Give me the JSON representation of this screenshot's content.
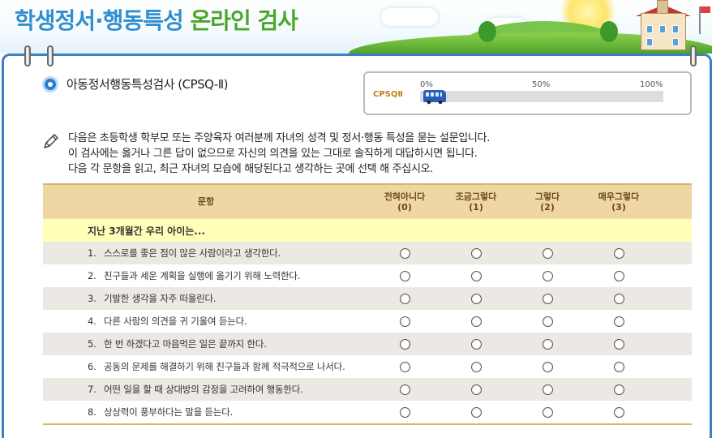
{
  "header": {
    "title_part1": "학생정서·행동특성 ",
    "title_part2": "온라인 검사"
  },
  "page": {
    "title": "아동정서행동특성검사 (CPSQ-Ⅱ)"
  },
  "progress": {
    "code": "CPSQⅡ",
    "ticks": [
      "0%",
      "50%",
      "100%"
    ],
    "percent": 0
  },
  "instructions": [
    "다음은 초등학생 학부모 또는 주양육자 여러분께 자녀의 성격 및 정서·행동 특성을 묻는 설문입니다.",
    "이 검사에는 옳거나 그른 답이 없으므로 자신의 의견을 있는 그대로 솔직하게 대답하시면 됩니다.",
    "다음 각 문항을 읽고, 최근 자녀의 모습에 해당된다고 생각하는 곳에 선택 해 주십시오."
  ],
  "table": {
    "col_question": "문항",
    "options": [
      {
        "label": "전혀아니다",
        "value": "(0)"
      },
      {
        "label": "조금그렇다",
        "value": "(1)"
      },
      {
        "label": "그렇다",
        "value": "(2)"
      },
      {
        "label": "매우그렇다",
        "value": "(3)"
      }
    ],
    "section": "지난 3개월간 우리 아이는...",
    "questions": [
      {
        "num": "1.",
        "text": "스스로를 좋은 점이 많은 사람이라고 생각한다."
      },
      {
        "num": "2.",
        "text": "친구들과 세운 계획을 실행에 옮기기 위해 노력한다."
      },
      {
        "num": "3.",
        "text": "기발한 생각을 자주 떠올린다."
      },
      {
        "num": "4.",
        "text": "다른 사람의 의견을 귀 기울여 듣는다."
      },
      {
        "num": "5.",
        "text": "한 번 하겠다고 마음먹은 일은 끝까지 한다."
      },
      {
        "num": "6.",
        "text": "공동의 문제를 해결하기 위해 친구들과 함께 적극적으로 나서다."
      },
      {
        "num": "7.",
        "text": "어떤 일을 할 때 상대방의 감정을 고려하여 행동한다."
      },
      {
        "num": "8.",
        "text": "상상력이 풍부하다는 말을 듣는다."
      }
    ]
  },
  "colors": {
    "frame": "#3d7fc1",
    "header_bg": "#efd7a3",
    "section_bg": "#ffffb8",
    "row_alt": "#ece8e3"
  },
  "icons": [
    "pencil-icon",
    "bus-icon",
    "title-bullet-icon",
    "binder-ring-icon"
  ]
}
